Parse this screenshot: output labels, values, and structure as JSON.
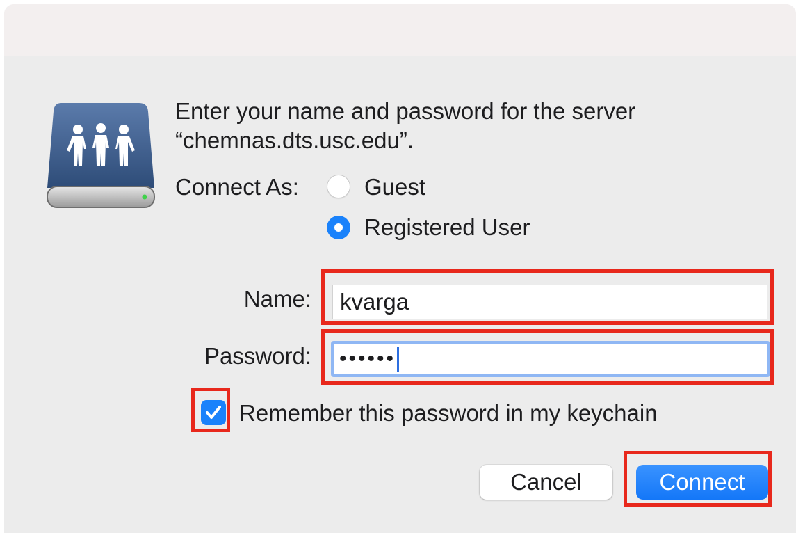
{
  "dialog": {
    "prompt_line1": "Enter your name and password for the server",
    "prompt_line2": "“chemnas.dts.usc.edu”.",
    "server_icon": "shared-server-icon"
  },
  "connect_as": {
    "label": "Connect As:",
    "options": [
      {
        "label": "Guest",
        "selected": false
      },
      {
        "label": "Registered User",
        "selected": true
      }
    ]
  },
  "fields": {
    "name_label": "Name:",
    "name_value": "kvarga",
    "password_label": "Password:",
    "password_value": "••••••"
  },
  "remember": {
    "label": "Remember this password in my keychain",
    "checked": true
  },
  "buttons": {
    "cancel": "Cancel",
    "connect": "Connect"
  },
  "colors": {
    "accent": "#1a82fb",
    "highlight": "#e8281c"
  }
}
